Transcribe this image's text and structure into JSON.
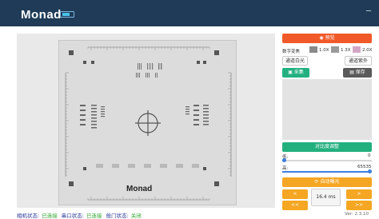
{
  "app": {
    "title": "Monad"
  },
  "status": {
    "camera_label": "相机状态:",
    "camera_value": "已连接",
    "serial_label": "串口状态:",
    "serial_value": "已连接",
    "door_label": "舱门状态:",
    "door_value": "关闭"
  },
  "target": {
    "brand": "Monad"
  },
  "panel": {
    "preview_label": "预览",
    "digital_gain_label": "数字变焦",
    "gains": [
      "1.0X",
      "1.3X",
      "2.0X"
    ],
    "gain_colors": [
      "#8a8a8a",
      "#9a9a9a",
      "#d4a6c6"
    ],
    "auto_wb_label": "通道白光",
    "auto_color_label": "通道紫外",
    "capture_label": "采集",
    "save_label": "保存",
    "contrast_label": "对比度调整",
    "low_label": "低:",
    "low_value": "0",
    "high_label": "高:",
    "high_value": "65535",
    "auto_exposure_label": "自动曝光",
    "prev_label": "<",
    "next_label": ">",
    "prev2_label": "<<",
    "next2_label": ">>",
    "exposure_value": "16.4 ms",
    "version": "Ver: 2.3.10"
  },
  "colors": {
    "topbar": "#1f3b57",
    "orange": "#f05a28",
    "green": "#23b07f",
    "amber": "#f5a623"
  }
}
